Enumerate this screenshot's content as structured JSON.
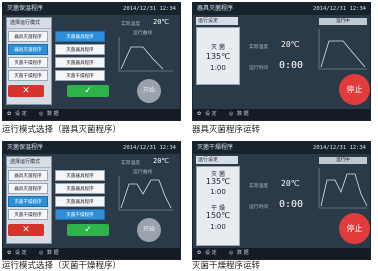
{
  "panels": [
    {
      "title": "灭菌保温程序",
      "datetime": "2014/12/31 12:34",
      "mode_header": "选择运行模式",
      "mode_buttons": [
        "器具灭菌程序",
        "灭菌干燥程序",
        "器具灭菌程序",
        "灭菌干燥程序"
      ],
      "programs": [
        "灭菌器具程序",
        "灭菌器具程序",
        "灭菌器具程序",
        "灭菌干燥程序"
      ],
      "temp_label": "实际温度",
      "temp_value": "20℃",
      "chart_label": "运行曲线",
      "x_button": "✕",
      "ok_button": "✓",
      "start_button": "开始",
      "bottom_items": [
        "设 定",
        "数 据"
      ],
      "caption": "运行模式选择（器具灭菌程序）"
    },
    {
      "title": "器具灭菌程序",
      "datetime": "2014/12/31 12:34",
      "header": "运行设定",
      "run_lines": [
        "灭 菌",
        "135℃",
        "1:00"
      ],
      "temp_label": "实际温度",
      "temp_value": "20℃",
      "time_label": "运行时间",
      "time_value": "0:00",
      "status_text": "运行中",
      "stop_button": "停止",
      "bottom_items": [
        "设 定",
        "数 据"
      ],
      "caption": "器具灭菌程序运转"
    },
    {
      "title": "灭菌保温程序",
      "datetime": "2014/12/31 12:34",
      "mode_header": "选择运行模式",
      "mode_buttons": [
        "器具灭菌程序",
        "灭菌干燥程序",
        "器具灭菌程序",
        "灭菌干燥程序"
      ],
      "programs": [
        "灭菌器具程序",
        "灭菌器具程序",
        "灭菌器具程序",
        "灭菌干燥程序"
      ],
      "temp_label": "实际温度",
      "temp_value": "20℃",
      "chart_label": "运行曲线",
      "x_button": "✕",
      "ok_button": "✓",
      "start_button": "开始",
      "bottom_items": [
        "设 定",
        "数 据"
      ],
      "caption": "运行模式选择（灭菌干燥程序）"
    },
    {
      "title": "灭菌干燥程序",
      "datetime": "2014/12/31 12:34",
      "header": "运行设定",
      "run_lines": [
        "灭 菌",
        "135℃",
        "1:00",
        "干 燥",
        "150℃",
        "1:00"
      ],
      "temp_label": "实际温度",
      "temp_value": "20℃",
      "time_label": "运行时间",
      "time_value": "0:00",
      "status_text": "运行中",
      "stop_button": "停止",
      "bottom_items": [
        "设 定",
        "数 据"
      ],
      "caption": "灭菌干燥程序运转"
    }
  ]
}
